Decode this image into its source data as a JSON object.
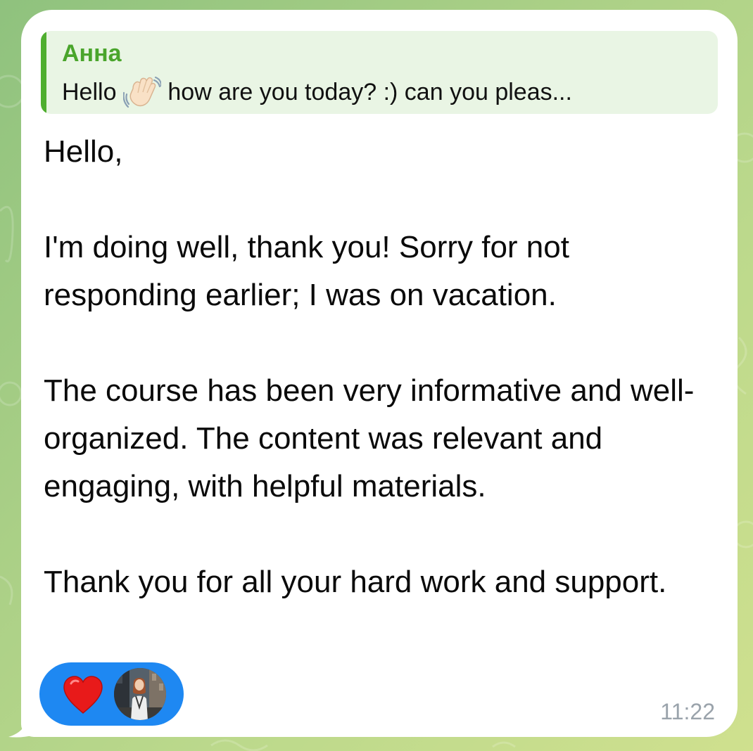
{
  "reply": {
    "sender": "Анна",
    "preview_before_emoji": "Hello ",
    "emoji_name": "waving-hand-icon",
    "preview_after_emoji": " how are you today? :) can you pleas..."
  },
  "message": {
    "paragraphs": [
      "Hello,",
      "I'm doing well, thank you! Sorry for not responding earlier; I was on vacation.",
      "The course has been very informative and well-organized. The content was relevant and engaging, with helpful materials.",
      "Thank you for all your hard work and support."
    ],
    "time": "11:22"
  },
  "reaction": {
    "emoji_name": "red-heart-icon",
    "reactor": "reactor-avatar"
  },
  "colors": {
    "reply_accent": "#4fae2f",
    "reply_background": "#e9f5e4",
    "reaction_pill": "#1e88f2",
    "heart": "#e81a1a",
    "timestamp": "#9aa3ab"
  }
}
